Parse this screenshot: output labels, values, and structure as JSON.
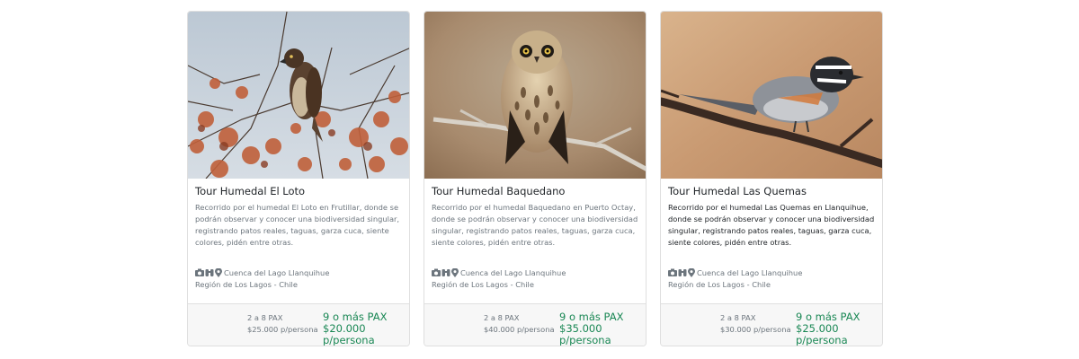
{
  "cards": [
    {
      "title": "Tour Humedal El Loto",
      "description": "Recorrido por el humedal El Loto en Frutillar, donde se podrán observar y conocer una biodiversidad singular, registrando patos reales, taguas, garza cuca, siente colores, pidén entre otras.",
      "location": "Cuenca del Lago Llanquihue",
      "region": "Región de Los Lagos - Chile",
      "tier1_label": "2 a 8 PAX",
      "tier1_price": "$25.000 p/persona",
      "tier2_label": "9 o más PAX",
      "tier2_price": "$20.000 p/persona",
      "image_icon": "hawk-photo"
    },
    {
      "title": "Tour Humedal Baquedano",
      "description": "Recorrido por el humedal Baquedano en Puerto Octay, donde se podrán observar y conocer una biodiversidad singular, registrando patos reales, taguas, garza cuca, siente colores, pidén entre otras.",
      "location": "Cuenca del Lago Llanquihue",
      "region": "Región de Los Lagos - Chile",
      "tier1_label": "2 a 8 PAX",
      "tier1_price": "$40.000 p/persona",
      "tier2_label": "9 o más PAX",
      "tier2_price": "$35.000 p/persona",
      "image_icon": "owl-photo"
    },
    {
      "title": "Tour Humedal Las Quemas",
      "description": "Recorrido por el humedal Las Quemas en Llanquihue, donde se podrán observar y conocer una biodiversidad singular, registrando patos reales, taguas, garza cuca, siente colores, pidén entre otras.",
      "location": "Cuenca del Lago Llanquihue",
      "region": "Región de Los Lagos - Chile",
      "tier1_label": "2 a 8 PAX",
      "tier1_price": "$30.000 p/persona",
      "tier2_label": "9 o más PAX",
      "tier2_price": "$25.000 p/persona",
      "image_icon": "songbird-photo"
    }
  ],
  "meta_icons": [
    "camera-icon",
    "binoculars-icon",
    "map-pin-icon"
  ],
  "colors": {
    "price_green": "#198754",
    "muted_text": "#6c757d",
    "footer_bg": "#f7f7f7"
  }
}
